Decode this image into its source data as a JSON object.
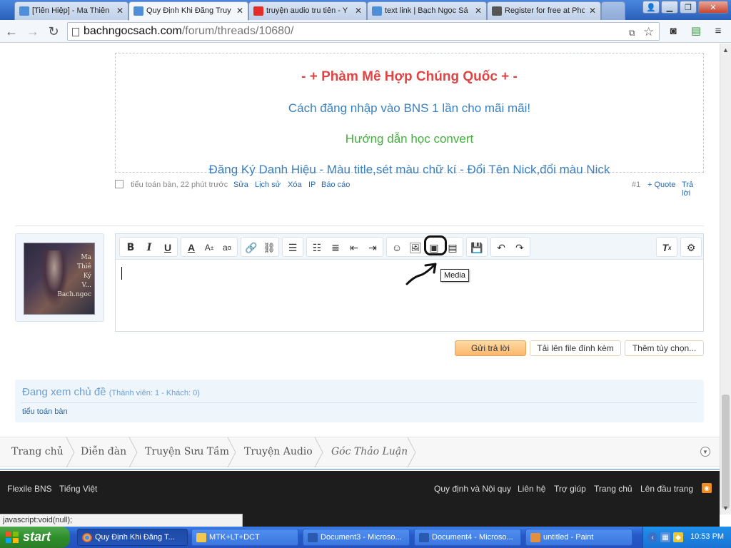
{
  "browser": {
    "tabs": [
      {
        "title": "[Tiên Hiệp] - Ma Thiên K",
        "favicon_color": "#4f8ed8"
      },
      {
        "title": "Quy Định Khi Đăng Truy",
        "favicon_color": "#4f8ed8"
      },
      {
        "title": "truyện audio tru tiên - Y",
        "favicon_color": "#e52d27"
      },
      {
        "title": "text link | Bạch Ngọc Sá",
        "favicon_color": "#4f8ed8"
      },
      {
        "title": "Register for free at Pho",
        "favicon_color": "#555555"
      }
    ],
    "active_tab_index": 1,
    "url_host": "bachngocsach.com",
    "url_path": "/forum/threads/10680/"
  },
  "signature": {
    "line1": "- + Phàm Mê Hợp Chúng Quốc + -",
    "line2": "Cách đăng nhập vào BNS 1 lần cho mãi mãi!",
    "line3": "Hướng dẫn học convert",
    "line4": "Đăng Ký Danh Hiệu - Màu title,sét màu chữ kí - Đổi Tên Nick,đổi màu Nick"
  },
  "post": {
    "author_time": "tiểu toán bàn, 22 phút trước",
    "links": {
      "edit": "Sửa",
      "history": "Lịch sử",
      "delete": "Xóa",
      "ip": "IP",
      "report": "Báo cáo"
    },
    "number": "#1",
    "quote": "+ Quote",
    "reply": "Trả lời"
  },
  "avatar": {
    "letters": [
      "Ma",
      "Thiê",
      "Ký",
      "V...",
      "Bach.ngoc"
    ]
  },
  "editor": {
    "tooltip": "Media",
    "buttons": {
      "bold": "B",
      "italic": "I",
      "underline": "U",
      "font_color": "A",
      "font_size": "A",
      "font_family": "a"
    }
  },
  "actions": {
    "submit": "Gửi trả lời",
    "upload": "Tải lên file đính kèm",
    "more": "Thêm tùy chọn..."
  },
  "viewers": {
    "title": "Đang xem chủ đề",
    "count": "(Thành viên: 1 - Khách: 0)",
    "member": "tiểu toán bàn"
  },
  "breadcrumbs": [
    "Trang chủ",
    "Diễn đàn",
    "Truyện Sưu Tầm",
    "Truyện Audio",
    "Góc Thảo Luận"
  ],
  "footer": {
    "left": [
      "Flexile BNS",
      "Tiếng Việt"
    ],
    "right": [
      "Quy định và Nội quy",
      "Liên hệ",
      "Trợ giúp",
      "Trang chủ",
      "Lên đầu trang"
    ]
  },
  "status_text": "javascript:void(null);",
  "taskbar": {
    "start": "start",
    "items": [
      {
        "label": "Quy Định Khi Đăng T...",
        "icon_color": "#e5c84a"
      },
      {
        "label": "MTK+LT+DCT",
        "icon_color": "#f0c850"
      },
      {
        "label": "Document3 - Microso...",
        "icon_color": "#2a5ab0"
      },
      {
        "label": "Document4 - Microso...",
        "icon_color": "#2a5ab0"
      },
      {
        "label": "untitled - Paint",
        "icon_color": "#e09040"
      }
    ],
    "clock": "10:53 PM"
  },
  "colors": {
    "sig_red": "#e04545",
    "sig_blue": "#3a7fbf",
    "sig_green": "#3fb03a",
    "link": "#2868b0",
    "reply_button": "#fbb86b"
  }
}
